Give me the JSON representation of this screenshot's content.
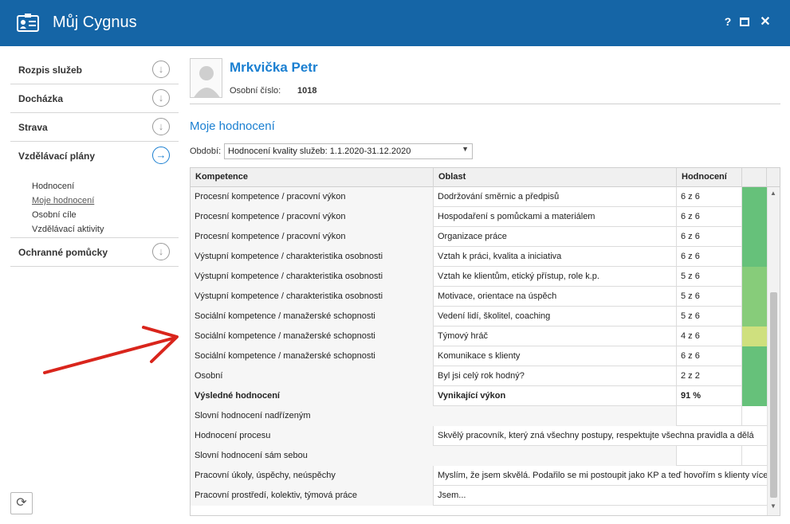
{
  "window": {
    "title": "Můj Cygnus",
    "help_label": "?",
    "close_label": "✕"
  },
  "sidebar": {
    "items": [
      {
        "label": "Rozpis služeb"
      },
      {
        "label": "Docházka"
      },
      {
        "label": "Strava"
      },
      {
        "label": "Vzdělávací plány"
      },
      {
        "label": "Ochranné pomůcky"
      }
    ],
    "sub_items": [
      {
        "label": "Hodnocení"
      },
      {
        "label": "Moje hodnocení"
      },
      {
        "label": "Osobní cíle"
      },
      {
        "label": "Vzdělávací aktivity"
      }
    ]
  },
  "employee": {
    "name": "Mrkvička Petr",
    "number_label": "Osobní číslo:",
    "number": "1018"
  },
  "section": {
    "title": "Moje hodnocení",
    "period_label": "Období:",
    "period_value": "Hodnocení kvality služeb: 1.1.2020-31.12.2020"
  },
  "table": {
    "headers": [
      "Kompetence",
      "Oblast",
      "Hodnocení"
    ],
    "rows": [
      {
        "competence": "Procesní kompetence / pracovní výkon",
        "area": "Dodržování směrnic a předpisů",
        "score": "6 z 6",
        "color": "#66c17a"
      },
      {
        "competence": "Procesní kompetence / pracovní výkon",
        "area": "Hospodaření s pomůckami a materiálem",
        "score": "6 z 6",
        "color": "#66c17a"
      },
      {
        "competence": "Procesní kompetence / pracovní výkon",
        "area": "Organizace práce",
        "score": "6 z 6",
        "color": "#66c17a"
      },
      {
        "competence": "Výstupní kompetence / charakteristika osobnosti",
        "area": "Vztah k práci, kvalita a iniciativa",
        "score": "6 z 6",
        "color": "#66c17a"
      },
      {
        "competence": "Výstupní kompetence / charakteristika osobnosti",
        "area": "Vztah ke klientům, etický přístup, role k.p.",
        "score": "5 z 6",
        "color": "#87cc7a"
      },
      {
        "competence": "Výstupní kompetence / charakteristika osobnosti",
        "area": "Motivace, orientace na úspěch",
        "score": "5 z 6",
        "color": "#87cc7a"
      },
      {
        "competence": "Sociální kompetence / manažerské schopnosti",
        "area": "Vedení lidí, školitel, coaching",
        "score": "5 z 6",
        "color": "#87cc7a"
      },
      {
        "competence": "Sociální kompetence / manažerské schopnosti",
        "area": "Týmový hráč",
        "score": "4 z 6",
        "color": "#cfe07e"
      },
      {
        "competence": "Sociální kompetence / manažerské schopnosti",
        "area": "Komunikace s klienty",
        "score": "6 z 6",
        "color": "#66c17a"
      },
      {
        "competence": "Osobní",
        "area": "Byl jsi celý rok hodný?",
        "score": "2 z 2",
        "color": "#66c17a"
      }
    ],
    "summary": {
      "competence": "Výsledné hodnocení",
      "area": "Vynikající výkon",
      "score": "91 %",
      "color": "#66c17a"
    },
    "comments": [
      {
        "label": "Slovní hodnocení nadřízeným",
        "text": ""
      },
      {
        "label": "Hodnocení procesu",
        "text": "Skvělý pracovník, který zná všechny postupy, respektujte všechna pravidla a dělá"
      },
      {
        "label": "Slovní hodnocení sám sebou",
        "text": ""
      },
      {
        "label": "Pracovní úkoly, úspěchy, neúspěchy",
        "text": "Myslím, že jsem skvělá. Podařilo se mi postoupit jako KP a teď hovořím s klienty více"
      },
      {
        "label": "Pracovní prostředí, kolektiv, týmová práce",
        "text": "Jsem..."
      }
    ]
  },
  "icons": {
    "app": "id-card-icon",
    "nav_collapsed": "circle-arrow-down-icon",
    "nav_active": "circle-arrow-right-icon",
    "refresh": "refresh-icon",
    "annotation": "red-arrow-icon"
  }
}
